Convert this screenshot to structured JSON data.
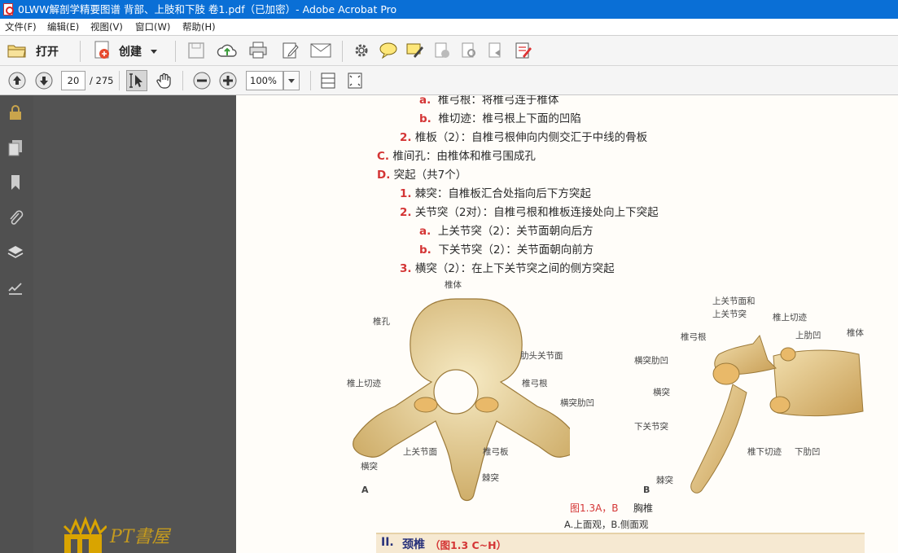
{
  "window": {
    "title": "0LWW解剖学精要图谱 背部、上肢和下肢 卷1.pdf（已加密）- Adobe Acrobat Pro"
  },
  "menu": [
    "文件(F)",
    "编辑(E)",
    "视图(V)",
    "窗口(W)",
    "帮助(H)"
  ],
  "toolbar": {
    "open_label": "打开",
    "create_label": "创建"
  },
  "nav": {
    "page_value": "20",
    "page_total": "/ 275",
    "zoom_value": "100%"
  },
  "document": {
    "lines": [
      {
        "label": "a.",
        "text": "椎弓根：将椎弓连于椎体"
      },
      {
        "label": "b.",
        "text": "椎切迹：椎弓根上下面的凹陷"
      },
      {
        "label": "2.",
        "text": "椎板（2）：自椎弓根伸向内侧交汇于中线的骨板"
      },
      {
        "label": "C.",
        "text": "椎间孔：由椎体和椎弓围成孔"
      },
      {
        "label": "D.",
        "text": "突起（共7个）"
      },
      {
        "label": "1.",
        "text": "棘突：自椎板汇合处指向后下方突起"
      },
      {
        "label": "2.",
        "text": "关节突（2对）：自椎弓根和椎板连接处向上下突起"
      },
      {
        "label": "a.",
        "text": "上关节突（2）：关节面朝向后方"
      },
      {
        "label": "b.",
        "text": "下关节突（2）：关节面朝向前方"
      },
      {
        "label": "3.",
        "text": "横突（2）：在上下关节突之间的侧方突起"
      }
    ],
    "figureA": {
      "letter": "A",
      "labels": [
        "椎体",
        "椎孔",
        "肋头关节面",
        "椎上切迹",
        "椎弓根",
        "横突肋凹",
        "上关节面",
        "椎弓板",
        "横突",
        "棘突"
      ]
    },
    "figureB": {
      "letter": "B",
      "labels": [
        "上关节面和",
        "上关节突",
        "椎上切迹",
        "椎弓根",
        "上肋凹",
        "椎体",
        "横突肋凹",
        "横突",
        "下关节突",
        "椎下切迹",
        "下肋凹",
        "棘突"
      ]
    },
    "caption": {
      "fig": "图1.3A，B",
      "title": "胸椎",
      "sub": "A.上面观，B.侧面观"
    },
    "section": {
      "num": "II.",
      "title": "颈椎",
      "ref": "（图1.3 C~H）"
    }
  },
  "watermark": {
    "text": "PT書屋"
  }
}
